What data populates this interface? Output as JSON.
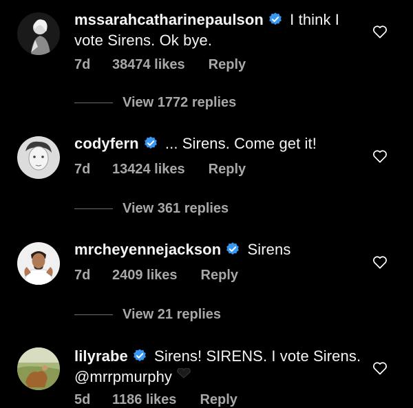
{
  "comments": [
    {
      "username": "mssarahcatharinepaulson",
      "text": "I think I vote Sirens. Ok bye.",
      "time": "7d",
      "likes": "38474 likes",
      "reply": "Reply",
      "view_replies": "View 1772 replies"
    },
    {
      "username": "codyfern",
      "text": "... Sirens. Come get it!",
      "time": "7d",
      "likes": "13424 likes",
      "reply": "Reply",
      "view_replies": "View 361 replies"
    },
    {
      "username": "mrcheyennejackson",
      "text": "Sirens",
      "time": "7d",
      "likes": "2409 likes",
      "reply": "Reply",
      "view_replies": "View 21 replies"
    },
    {
      "username": "lilyrabe",
      "text": "Sirens! SIRENS. I vote Sirens. @mrrpmurphy",
      "time": "5d",
      "likes": "1186 likes",
      "reply": "Reply"
    }
  ],
  "colors": {
    "background": "#000000",
    "verified": "#3897f0",
    "secondary_text": "#a8a8a8"
  },
  "icons": {
    "verified": "verified-badge-icon",
    "like": "heart-outline-icon"
  }
}
